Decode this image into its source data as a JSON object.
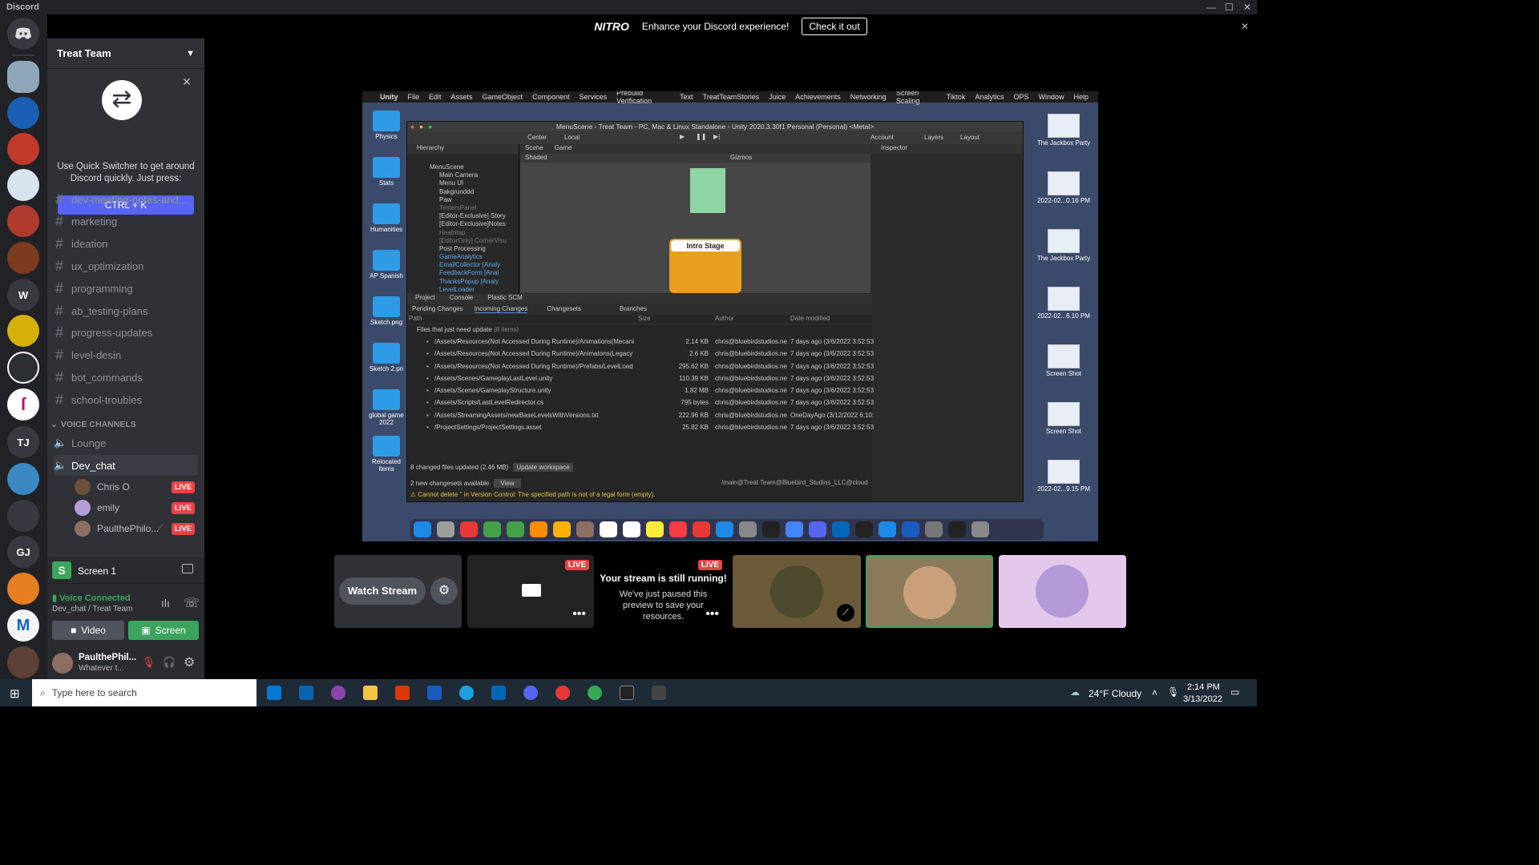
{
  "window": {
    "title": "Discord",
    "controls": [
      "—",
      "☐",
      "✕"
    ]
  },
  "nitro": {
    "logo": "NITRO",
    "text": "Enhance your Discord experience!",
    "button": "Check it out",
    "close": "✕"
  },
  "server": {
    "name": "Treat Team"
  },
  "rail": {
    "servers": [
      {
        "label": "W",
        "color": "#36393f"
      },
      {
        "label": "TJ",
        "color": "#36393f"
      },
      {
        "label": "GJ",
        "color": "#36393f"
      }
    ]
  },
  "quickswitcher": {
    "text": "Use Quick Switcher to get around Discord quickly. Just press:",
    "button": "CTRL + K"
  },
  "channels": [
    "dev-meeting-notes-and...",
    "marketing",
    "ideation",
    "ux_optimization",
    "programming",
    "ab_testing-plans",
    "progress-updates",
    "level-desin",
    "bot_commands",
    "school-troubles"
  ],
  "voice": {
    "header": "VOICE CHANNELS",
    "lounge": "Lounge",
    "dev_chat": "Dev_chat",
    "users": [
      {
        "name": "Chris O",
        "live": "LIVE"
      },
      {
        "name": "emily",
        "live": "LIVE"
      },
      {
        "name": "PaulthePhilo...",
        "live": "LIVE"
      }
    ]
  },
  "screen": {
    "icon": "S",
    "label": "Screen 1"
  },
  "connection": {
    "status": "Voice Connected",
    "channel": "Dev_chat / Treat Team",
    "video": "Video",
    "screen": "Screen"
  },
  "user": {
    "name": "PaulthePhil...",
    "status": "Whatever t..."
  },
  "unity": {
    "menubar": [
      "Unity",
      "File",
      "Edit",
      "Assets",
      "GameObject",
      "Component",
      "Services",
      "Prebuild Verification",
      "Text",
      "TreatTeamStories",
      "Juice",
      "Achievements",
      "Networking",
      "Screen Scaling",
      "Tiktok",
      "Analytics",
      "OPS",
      "Window",
      "Help"
    ],
    "title": "MenuScene - Treat Team - PC, Mac & Linux Standalone - Unity 2020.3.30f1 Personal (Personal) <Metal>",
    "toolbar": {
      "center": "Center",
      "local": "Local",
      "account": "Account",
      "layers": "Layers",
      "layout": "Layout"
    },
    "hierarchy": {
      "title": "Hierarchy",
      "items": [
        "MenuScene",
        "Main Camera",
        "Menu UI",
        "Bakgrunddd",
        "Paw",
        "TestersPanel",
        "[Editor-Exclusive] Story",
        "[Editor-Exclusive]Notes",
        "Heatmap",
        "[EditorOnly] CornerVisu",
        "Post Processing",
        "GameAnalytics",
        "EmailCollector [Analy",
        "FeedbackForm [Anal",
        "ThanksPopup [Analy",
        "LevelLoader"
      ]
    },
    "scene": {
      "tabs": [
        "Scene",
        "Game"
      ],
      "shaded": "Shaded",
      "gizmos": "Gizmos",
      "stage": "Intro Stage"
    },
    "inspector": {
      "title": "Inspector"
    },
    "bottomtabs": [
      "Project",
      "Console",
      "Plastic SCM"
    ],
    "scm": {
      "tabs": [
        "Pending Changes",
        "Incoming Changes",
        "Changesets",
        "Branches"
      ],
      "cols": [
        "Path",
        "Size",
        "Author",
        "Date modified"
      ],
      "group": "Files that just need update",
      "count": "(8 items)",
      "rows": [
        {
          "p": "/Assets/Resources(Not Accessed During Runtime)/Animations(Mecani",
          "s": "2.14 KB",
          "a": "chris@bluebirdstudios.ne",
          "d": "7 days ago (3/6/2022 3:52:53"
        },
        {
          "p": "/Assets/Resources(Not Accessed During Runtime)/Animatons(Legacy",
          "s": "2.6 KB",
          "a": "chris@bluebirdstudios.ne",
          "d": "7 days ago (3/6/2022 3:52:53"
        },
        {
          "p": "/Assets/Resources(Not Accessed During Runtime)/Prefabs/LevelLoad",
          "s": "295.62 KB",
          "a": "chris@bluebirdstudios.ne",
          "d": "7 days ago (3/6/2022 3:52:53"
        },
        {
          "p": "/Assets/Scenes/GameplayLastLevel.unity",
          "s": "110.39 KB",
          "a": "chris@bluebirdstudios.ne",
          "d": "7 days ago (3/6/2022 3:52:53"
        },
        {
          "p": "/Assets/Scenes/GameplayStructure.unity",
          "s": "1.82 MB",
          "a": "chris@bluebirdstudios.ne",
          "d": "7 days ago (3/6/2022 3:52:53"
        },
        {
          "p": "/Assets/Scripts/LastLevelRedirector.cs",
          "s": "795 bytes",
          "a": "chris@bluebirdstudios.ne",
          "d": "7 days ago (3/6/2022 3:52:53"
        },
        {
          "p": "/Assets/StreamingAssets/newBaseLevelsWithVersions.txt",
          "s": "222.96 KB",
          "a": "chris@bluebirdstudios.ne",
          "d": "OneDayAgo (3/12/2022 6:10:"
        },
        {
          "p": "/ProjectSettings/ProjectSettings.asset",
          "s": "25.82 KB",
          "a": "chris@bluebirdstudios.ne",
          "d": "7 days ago (3/6/2022 3:52:53"
        }
      ],
      "summary": "8 changed files updated (2.46 MB)",
      "update": "Update workspace",
      "changesets": "2 new changesets available",
      "view": "View",
      "repo": "/main@Treat Team@Bluebird_Studios_LLC@cloud",
      "error": "Cannot delete '' in Version Control: The specified path is not of a legal form (empty)."
    }
  },
  "desktop": {
    "left": [
      "Physics",
      "Stats",
      "Humanities",
      "AP Spanish",
      "Sketch.png",
      "Sketch 2.pn",
      "global game 2022",
      "Relocated Items"
    ],
    "right": [
      "The Jackbox Party",
      "2022-02...0.16 PM",
      "The Jackbox Party",
      "2022-02...6.10 PM",
      "Screen Shot",
      "Screen Shot",
      "2022-02...9.15 PM"
    ]
  },
  "tiles": {
    "watch": "Watch Stream",
    "live": "LIVE",
    "running_title": "Your stream is still running!",
    "running_text": "We've just paused this preview to save your resources."
  },
  "taskbar": {
    "search": "Type here to search",
    "weather": "24°F  Cloudy",
    "time": "2:14 PM",
    "date": "3/13/2022"
  }
}
